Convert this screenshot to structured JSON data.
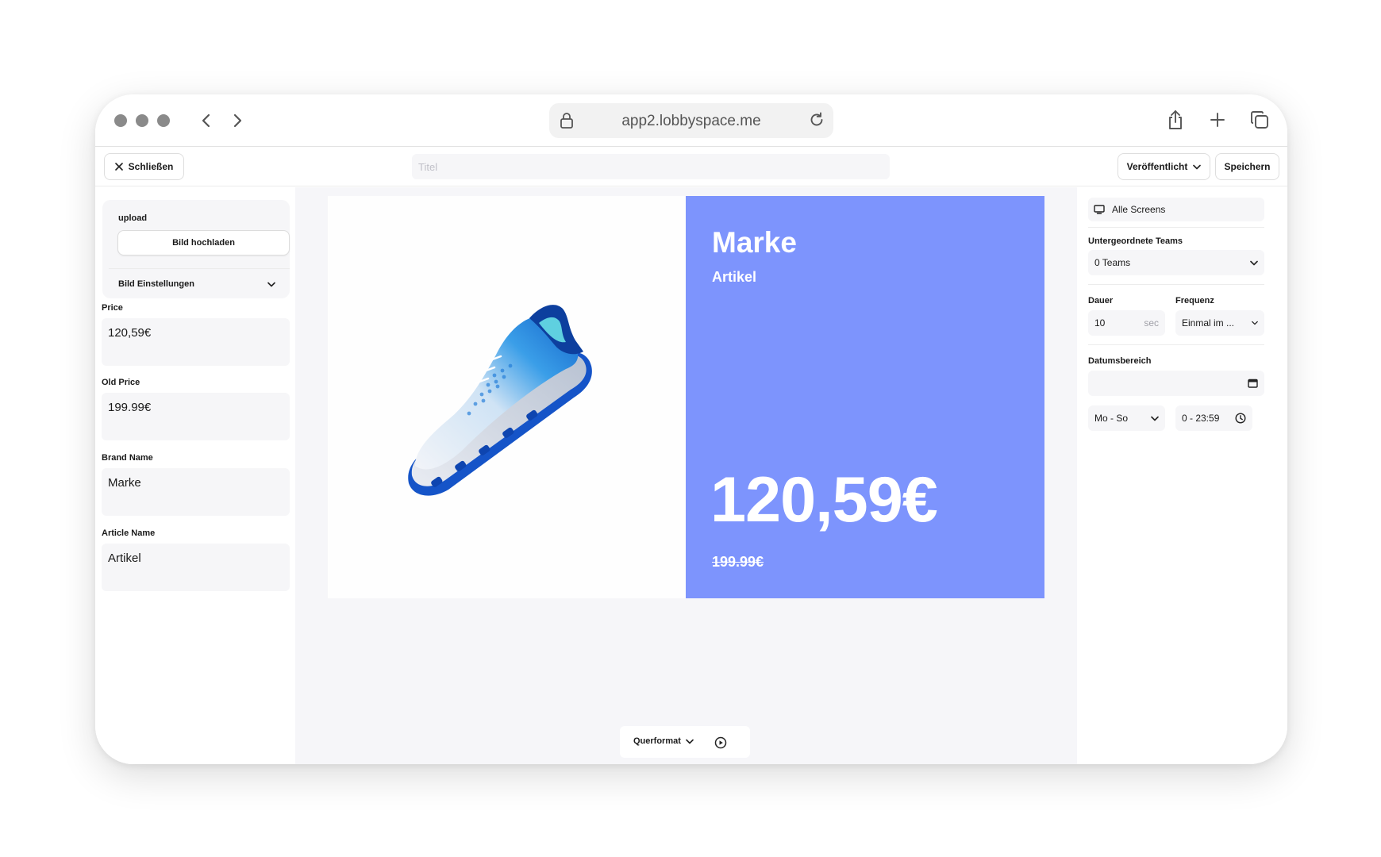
{
  "browser": {
    "url": "app2.lobbyspace.me"
  },
  "toolbar": {
    "close_label": "Schließen",
    "title_placeholder": "Titel",
    "title_value": "",
    "status_label": "Veröffentlicht",
    "save_label": "Speichern"
  },
  "left_panel": {
    "upload_label": "upload",
    "upload_button": "Bild hochladen",
    "image_settings": "Bild Einstellungen",
    "fields": [
      {
        "label": "Price",
        "value": "120,59€"
      },
      {
        "label": "Old Price",
        "value": "199.99€"
      },
      {
        "label": "Brand Name",
        "value": "Marke"
      },
      {
        "label": "Article Name",
        "value": "Artikel"
      }
    ]
  },
  "slide": {
    "brand": "Marke",
    "article": "Artikel",
    "price": "120,59€",
    "old_price": "199.99€",
    "accent_color": "#7d94fd"
  },
  "canvas_bar": {
    "format": "Querformat"
  },
  "right_panel": {
    "screens": "Alle Screens",
    "teams_label": "Untergeordnete Teams",
    "teams_value": "0 Teams",
    "duration_label": "Dauer",
    "duration_value": "10",
    "duration_unit": "sec",
    "frequency_label": "Frequenz",
    "frequency_value": "Einmal im ...",
    "date_range_label": "Datumsbereich",
    "date_range_value": "",
    "days_value": "Mo - So",
    "time_value": "0 - 23:59"
  }
}
